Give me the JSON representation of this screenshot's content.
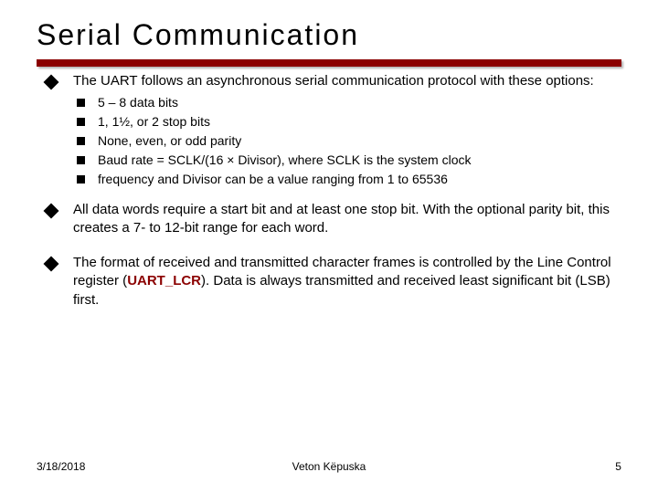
{
  "title": "Serial Communication",
  "bullets": [
    {
      "text": "The UART follows an asynchronous serial communication protocol with these options:",
      "sub": [
        "5 – 8 data bits",
        "1, 1½, or 2 stop bits",
        "None, even, or odd parity",
        "Baud rate = SCLK/(16 × Divisor), where SCLK is the system clock",
        "frequency and Divisor can be a value ranging from 1 to 65536"
      ]
    },
    {
      "text_pre": "All data words require a start bit and at least one stop bit. With the optional parity bit, this creates a 7- to 12-bit range for each word."
    },
    {
      "text_pre": "The format of received and transmitted character frames is controlled by the Line Control register (",
      "register": "UART_LCR",
      "text_post": "). Data is always transmitted and received least significant bit (LSB) first."
    }
  ],
  "footer": {
    "date": "3/18/2018",
    "author": "Veton Këpuska",
    "page": "5"
  }
}
